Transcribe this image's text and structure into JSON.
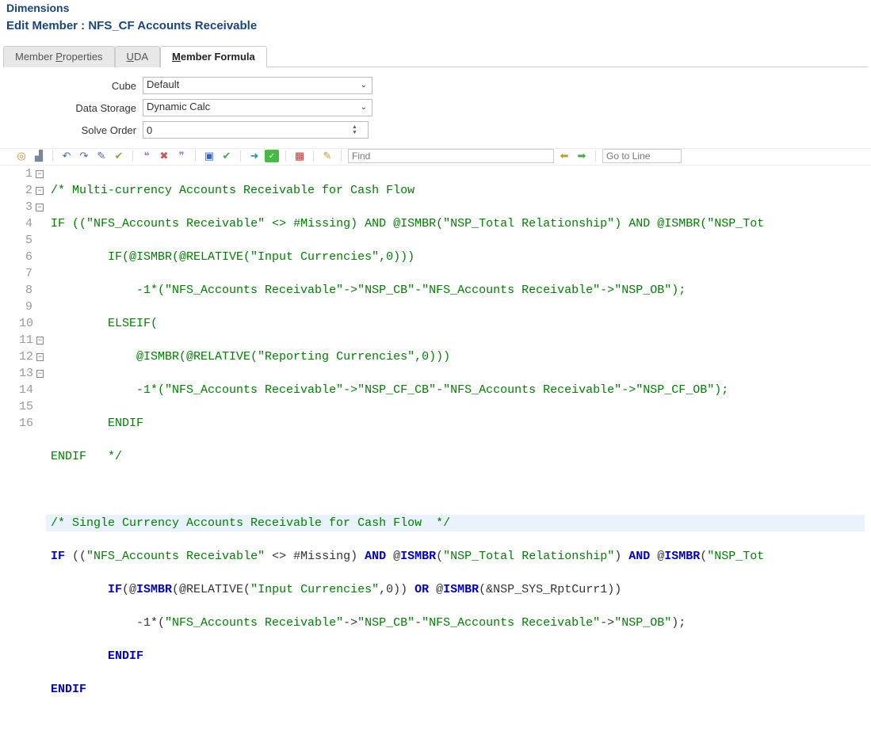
{
  "header": {
    "breadcrumb": "Dimensions",
    "title": "Edit Member : NFS_CF Accounts Receivable"
  },
  "tabs": [
    {
      "id": "props",
      "label_pre": "Member ",
      "accel": "P",
      "label_post": "roperties"
    },
    {
      "id": "uda",
      "label_pre": "",
      "accel": "U",
      "label_post": "DA"
    },
    {
      "id": "formula",
      "label_pre": "",
      "accel": "M",
      "label_post": "ember Formula"
    }
  ],
  "form": {
    "cube_label": "Cube",
    "cube_value": "Default",
    "storage_label": "Data Storage",
    "storage_value": "Dynamic Calc",
    "solve_label": "Solve Order",
    "solve_value": "0"
  },
  "toolbar": {
    "find_placeholder": "Find",
    "goto_placeholder": "Go to Line"
  },
  "code": {
    "l1": "/* Multi-currency Accounts Receivable for Cash Flow",
    "l2a": "IF",
    "l2b": " ((",
    "l2s1": "\"NFS_Accounts Receivable\"",
    "l2c": " <> #Missing) ",
    "l2d": "AND",
    "l2e": " @ISMBR(",
    "l2s2": "\"NSP_Total Relationship\"",
    "l2f": ") ",
    "l2g": "AND",
    "l2h": " @ISMBR(",
    "l2s3": "\"NSP_Tot",
    "l3a": "        IF",
    "l3b": "(@ISMBR(@RELATIVE(",
    "l3s1": "\"Input Currencies\"",
    "l3c": ",0)))",
    "l4a": "            -1*(",
    "l4s1": "\"NFS_Accounts Receivable\"",
    "l4b": "->",
    "l4s2": "\"NSP_CB\"",
    "l4c": "-",
    "l4s3": "\"NFS_Accounts Receivable\"",
    "l4d": "->",
    "l4s4": "\"NSP_OB\"",
    "l4e": ");",
    "l5a": "        ELSEIF",
    "l5b": "(",
    "l6a": "            @ISMBR(@RELATIVE(",
    "l6s1": "\"Reporting Currencies\"",
    "l6b": ",0)))",
    "l7a": "            -1*(",
    "l7s1": "\"NFS_Accounts Receivable\"",
    "l7b": "->",
    "l7s2": "\"NSP_CF_CB\"",
    "l7c": "-",
    "l7s3": "\"NFS_Accounts Receivable\"",
    "l7d": "->",
    "l7s4": "\"NSP_CF_OB\"",
    "l7e": ");",
    "l8": "        ENDIF",
    "l9a": "ENDIF",
    "l9b": "   */",
    "l11": "/* Single Currency Accounts Receivable for Cash Flow  */",
    "l12a": "IF",
    "l12b": " ((",
    "l12s1": "\"NFS_Accounts Receivable\"",
    "l12c": " <> #Missing) ",
    "l12d": "AND",
    "l12e": " @",
    "l12f": "ISMBR",
    "l12g": "(",
    "l12s2": "\"NSP_Total Relationship\"",
    "l12h": ") ",
    "l12i": "AND",
    "l12j": " @",
    "l12k": "ISMBR",
    "l12l": "(",
    "l12s3": "\"NSP_Tot",
    "l13a": "        IF",
    "l13b": "(@",
    "l13c": "ISMBR",
    "l13d": "(@RELATIVE(",
    "l13s1": "\"Input Currencies\"",
    "l13e": ",0)) ",
    "l13f": "OR",
    "l13g": " @",
    "l13h": "ISMBR",
    "l13i": "(&NSP_SYS_RptCurr1))",
    "l14a": "            -1*(",
    "l14s1": "\"NFS_Accounts Receivable\"",
    "l14b": "->",
    "l14s2": "\"NSP_CB\"",
    "l14c": "-",
    "l14s3": "\"NFS_Accounts Receivable\"",
    "l14d": "->",
    "l14s4": "\"NSP_OB\"",
    "l14e": ");",
    "l15": "        ENDIF",
    "l16": "ENDIF"
  },
  "lines": [
    "1",
    "2",
    "3",
    "4",
    "5",
    "6",
    "7",
    "8",
    "9",
    "10",
    "11",
    "12",
    "13",
    "14",
    "15",
    "16"
  ]
}
